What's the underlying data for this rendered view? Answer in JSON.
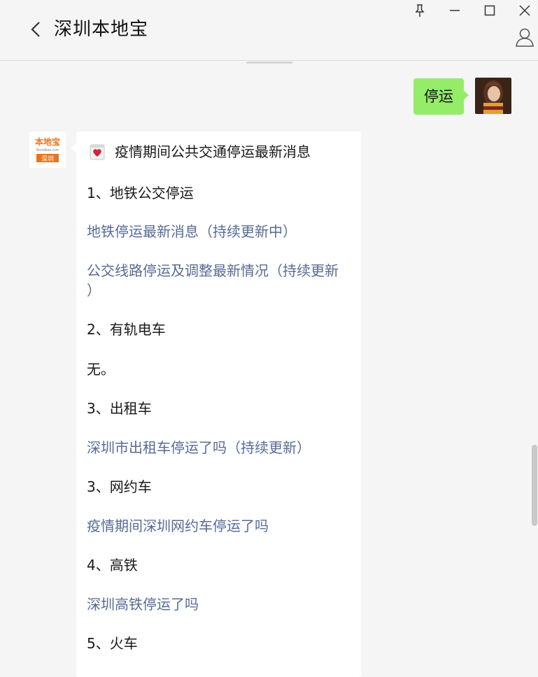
{
  "header": {
    "title": "深圳本地宝",
    "back_icon": "back-chevron-icon",
    "pin_icon": "pin-icon",
    "minimize_icon": "minimize-icon",
    "maximize_icon": "maximize-icon",
    "close_icon": "close-icon",
    "profile_icon": "person-icon"
  },
  "messages": {
    "outgoing": {
      "text": "停运",
      "bubble_color": "#95ec69"
    },
    "incoming": {
      "account_logo": {
        "line1": "本地宝",
        "line2": "Bendibao.com",
        "line3": "深圳",
        "accent": "#e8751a"
      },
      "title": "疫情期间公共交通停运最新消息",
      "lines": [
        {
          "text": "1、地铁公交停运",
          "type": "heading"
        },
        {
          "text": "地铁停运最新消息（持续更新中）",
          "type": "link"
        },
        {
          "text": "公交线路停运及调整最新情况（持续更新",
          "type": "link"
        },
        {
          "text": "）",
          "type": "link"
        },
        {
          "text": "2、有轨电车",
          "type": "heading"
        },
        {
          "text": "无。",
          "type": "text"
        },
        {
          "text": "3、出租车",
          "type": "heading"
        },
        {
          "text": "深圳市出租车停运了吗（持续更新）",
          "type": "link"
        },
        {
          "text": "3、网约车",
          "type": "heading"
        },
        {
          "text": "疫情期间深圳网约车停运了吗",
          "type": "link"
        },
        {
          "text": "4、高铁",
          "type": "heading"
        },
        {
          "text": "深圳高铁停运了吗",
          "type": "link"
        },
        {
          "text": "5、火车",
          "type": "heading"
        }
      ],
      "link_color": "#576b95"
    }
  }
}
